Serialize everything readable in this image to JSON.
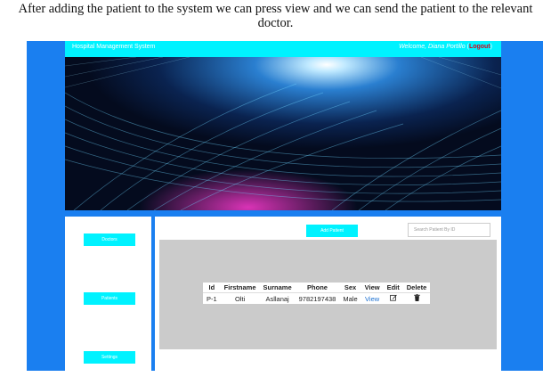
{
  "caption": "After adding the patient to the system we can press view and we can send the patient to the relevant doctor.",
  "header": {
    "brand": "Hospital Management System",
    "welcome_prefix": "Welcome, Diana Portillo",
    "logout_open": "(",
    "logout": "Logout",
    "logout_close": ")"
  },
  "sidebar": {
    "items": [
      {
        "label": "Doctors"
      },
      {
        "label": "Patients"
      },
      {
        "label": "Settings"
      }
    ]
  },
  "main": {
    "add_label": "Add Patient",
    "search_placeholder": "Search Patient By ID"
  },
  "table": {
    "headers": [
      "Id",
      "Firstname",
      "Surname",
      "Phone",
      "Sex",
      "View",
      "Edit",
      "Delete"
    ],
    "rows": [
      {
        "id": "P-1",
        "firstname": "Olti",
        "surname": "Asllanaj",
        "phone": "9782197438",
        "sex": "Male",
        "view": "View",
        "edit_icon": "edit-icon",
        "delete_icon": "trash-icon"
      }
    ]
  },
  "colors": {
    "accent": "#00f2ff",
    "frame": "#1a7ff0",
    "logout": "#d0021b",
    "panel_gray": "#cbcbcb"
  }
}
